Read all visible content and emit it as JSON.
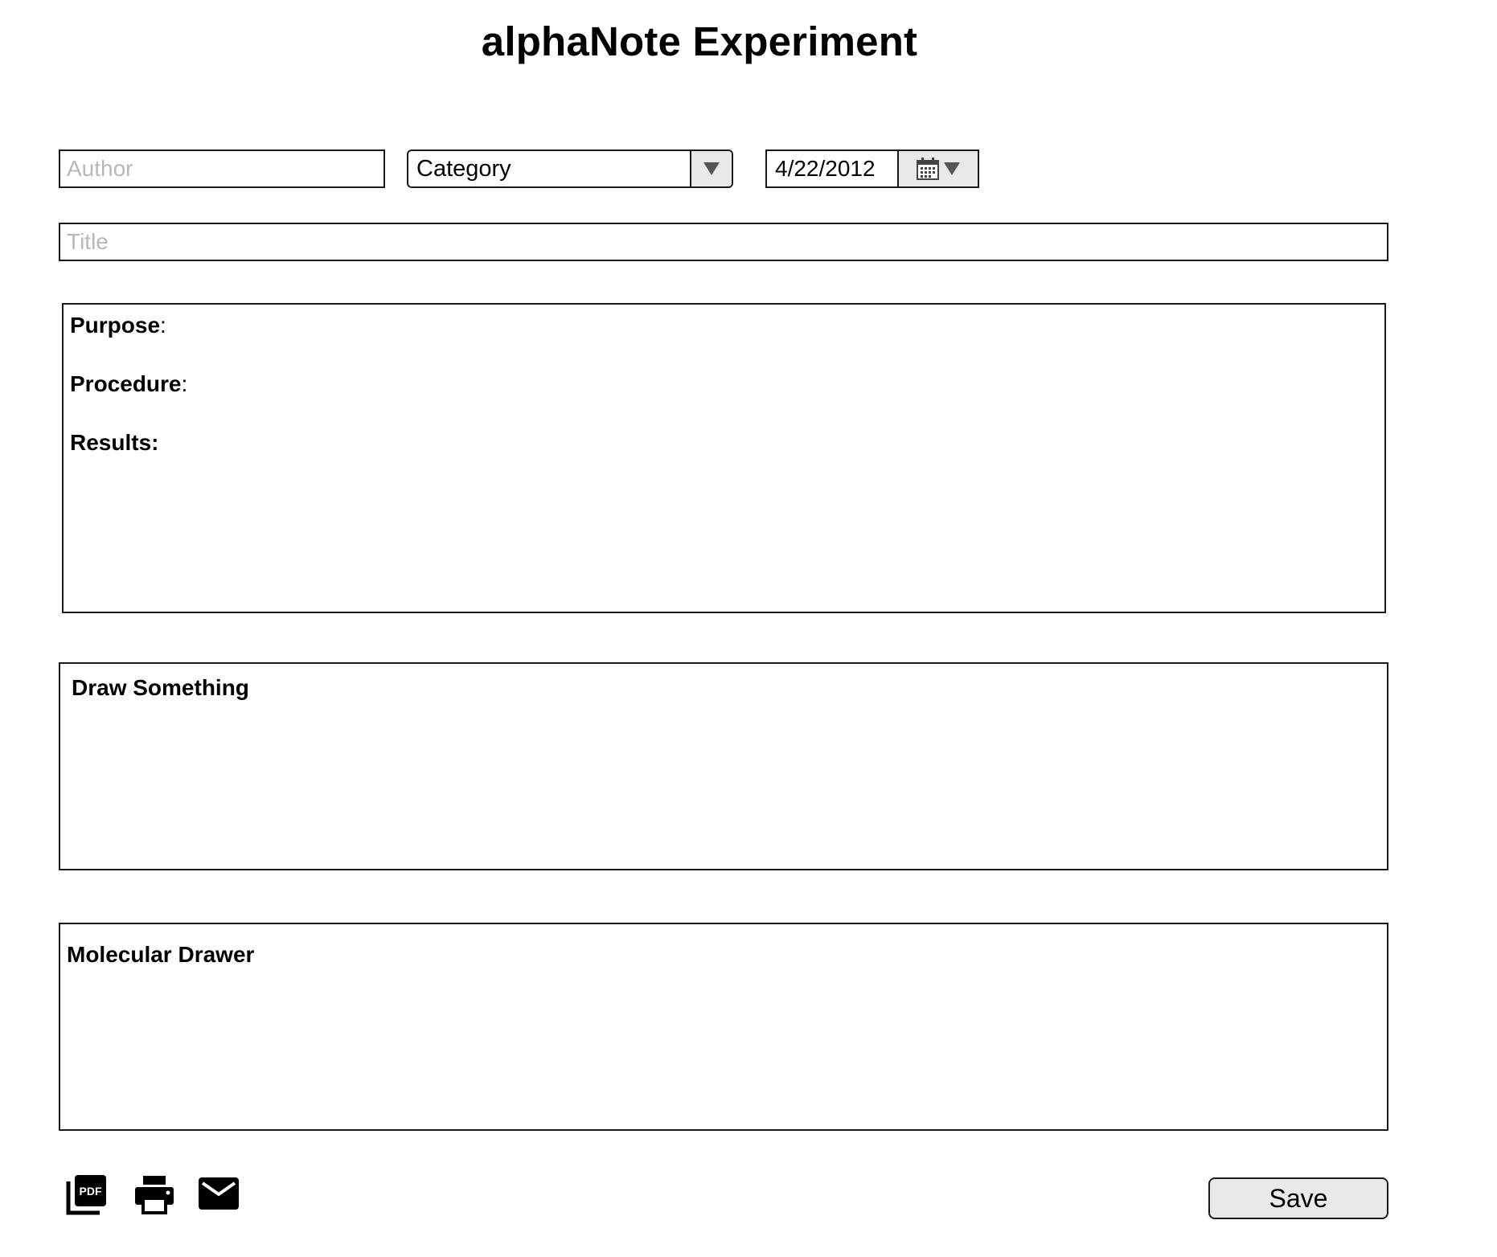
{
  "header": {
    "title": "alphaNote Experiment"
  },
  "form": {
    "author_placeholder": "Author",
    "category_value": "Category",
    "date_value": "4/22/2012",
    "title_placeholder": "Title"
  },
  "notes": {
    "purpose_label": "Purpose",
    "procedure_label": "Procedure",
    "results_label": "Results:",
    "colon": ":"
  },
  "panels": {
    "draw_label": "Draw Something",
    "molecular_label": "Molecular Drawer"
  },
  "footer": {
    "pdf_icon_text": "PDF",
    "save_label": "Save"
  },
  "icons": [
    "pdf-icon",
    "print-icon",
    "mail-icon",
    "calendar-icon",
    "dropdown-arrow-icon"
  ],
  "colors": {
    "border": "#1a1a1a",
    "button_bg": "#e9e9e9",
    "placeholder": "#b8b8b8"
  }
}
